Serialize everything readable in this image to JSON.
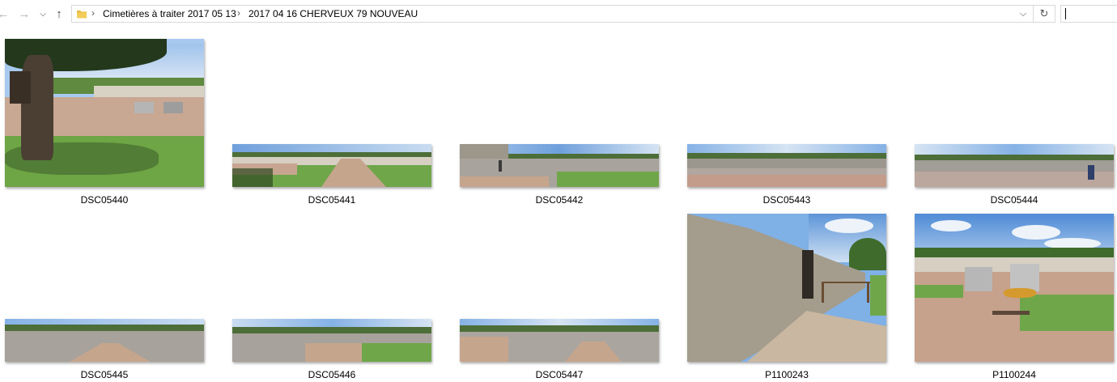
{
  "nav": {
    "back_icon": "arrow-left-icon",
    "forward_icon": "arrow-right-icon",
    "recent_icon": "chevron-down-icon",
    "up_icon": "arrow-up-icon"
  },
  "address": {
    "folder_icon": "folder-icon",
    "crumbs": [
      "Cimetières à traiter 2017 05 13",
      "2017 04 16 CHERVEUX 79 NOUVEAU"
    ],
    "separator": "›",
    "dropdown_glyph": "⌵",
    "refresh_glyph": "↻"
  },
  "search": {
    "value": ""
  },
  "files": [
    {
      "name": "DSC05440"
    },
    {
      "name": "DSC05441"
    },
    {
      "name": "DSC05442"
    },
    {
      "name": "DSC05443"
    },
    {
      "name": "DSC05444"
    },
    {
      "name": "DSC05445"
    },
    {
      "name": "DSC05446"
    },
    {
      "name": "DSC05447"
    },
    {
      "name": "P1100243"
    },
    {
      "name": "P1100244"
    }
  ],
  "colors": {
    "address_border": "#d9d9d9",
    "folder": "#e8b93c",
    "sky": "#7fb0e6",
    "grass": "#6fa64a",
    "gravel": "#c9a58e",
    "wall": "#a49c8c"
  }
}
